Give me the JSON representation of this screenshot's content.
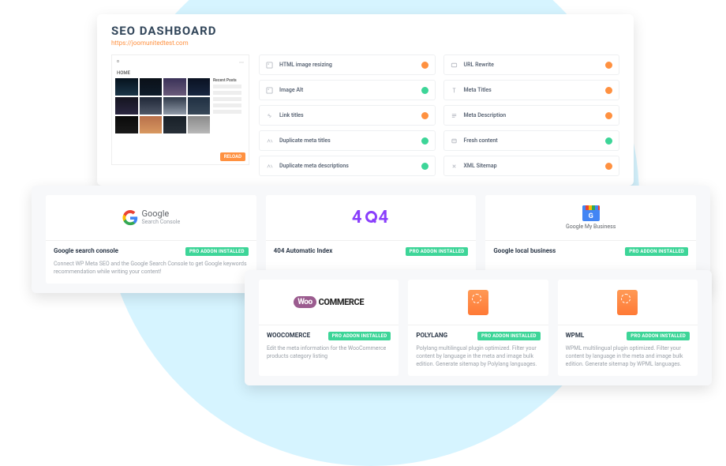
{
  "header": {
    "title": "SEO DASHBOARD",
    "url": "https://joomunitedtest.com"
  },
  "preview": {
    "home_label": "HOME",
    "reload_label": "RELOAD",
    "sidebar_title": "Recent Posts"
  },
  "status_left": [
    {
      "icon": "image-icon",
      "label": "HTML image resizing",
      "status": "orange"
    },
    {
      "icon": "image-icon",
      "label": "Image Alt",
      "status": "green"
    },
    {
      "icon": "link-icon",
      "label": "Link titles",
      "status": "orange"
    },
    {
      "icon": "duplicate-icon",
      "label": "Duplicate meta titles",
      "status": "green"
    },
    {
      "icon": "duplicate-icon",
      "label": "Duplicate meta descriptions",
      "status": "green"
    }
  ],
  "status_right": [
    {
      "icon": "url-icon",
      "label": "URL Rewrite",
      "status": "orange"
    },
    {
      "icon": "title-icon",
      "label": "Meta Titles",
      "status": "orange"
    },
    {
      "icon": "desc-icon",
      "label": "Meta Description",
      "status": "orange"
    },
    {
      "icon": "fresh-icon",
      "label": "Fresh content",
      "status": "green"
    },
    {
      "icon": "sitemap-icon",
      "label": "XML Sitemap",
      "status": "orange"
    }
  ],
  "badge_label": "PRO ADDON INSTALLED",
  "mid": [
    {
      "logo": "google-sc",
      "logo_name": "Google",
      "logo_sub": "Search Console",
      "title": "Google search console",
      "desc": "Connect WP Meta SEO and the Google Search Console to get Google keywords recommendation while writing your content!"
    },
    {
      "logo": "404",
      "title": "404 Automatic Index",
      "desc": ""
    },
    {
      "logo": "gmb",
      "logo_sub": "Google My Business",
      "title": "Google local business",
      "desc": ""
    }
  ],
  "bot": [
    {
      "logo": "woo",
      "logo_bubble": "Woo",
      "logo_text": "COMMERCE",
      "title": "WOOCOMERCE",
      "desc": "Edit the meta information for the WooCommerce products category listing"
    },
    {
      "logo": "plug",
      "title": "POLYLANG",
      "desc": "Polylang multilingual plugin optimized. Filter your content by language in the meta and image bulk edition. Generate sitemap by Polylang languages."
    },
    {
      "logo": "plug",
      "title": "WPML",
      "desc": "WPML multilingual plugin optimized. Filter your content by language in the meta and image bulk edition. Generate sitemap by WPML languages."
    }
  ]
}
